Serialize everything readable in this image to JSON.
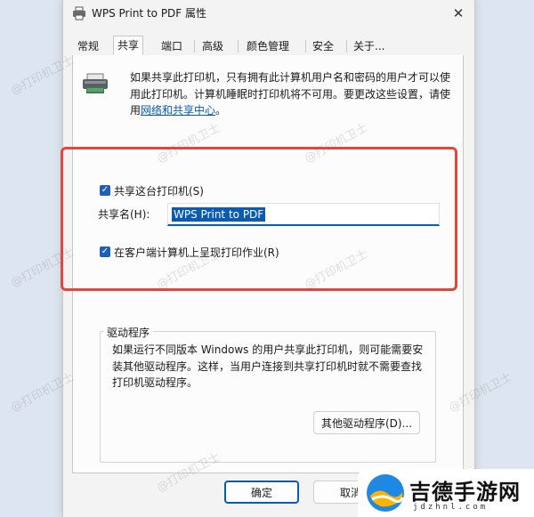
{
  "window": {
    "title": "WPS Print to PDF 属性",
    "close_glyph": "✕"
  },
  "tabs": [
    {
      "label": "常规"
    },
    {
      "label": "共享",
      "active": true
    },
    {
      "label": "端口"
    },
    {
      "label": "高级"
    },
    {
      "label": "颜色管理"
    },
    {
      "label": "安全"
    },
    {
      "label": "关于..."
    }
  ],
  "info": {
    "line1": "如果共享此打印机，只有拥有此计算机用户名和密码的用户才可以使",
    "line2": "用此打印机。计算机睡眠时打印机将不可用。要更改这些设置，请使",
    "line3_prefix": "用",
    "link": "网络和共享中心",
    "line3_suffix": "。"
  },
  "share": {
    "checkbox_label": "共享这台打印机(S)",
    "checked": true,
    "name_label": "共享名(H):",
    "name_value": "WPS Print to PDF",
    "render_label": "在客户端计算机上呈现打印作业(R)",
    "render_checked": true
  },
  "drivers": {
    "legend": "驱动程序",
    "line1": "如果运行不同版本 Windows 的用户共享此打印机，则可能需要安",
    "line2": "装其他驱动程序。这样，当用户连接到共享打印机时就不需要查找",
    "line3": "打印机驱动程序。",
    "button_label": "其他驱动程序(D)..."
  },
  "buttons": {
    "ok": "确定",
    "cancel": "取消"
  },
  "watermark_text": "@打印机卫士",
  "site_logo": {
    "title": "吉德手游网",
    "domain": "jdzhnl.com"
  },
  "colors": {
    "accent": "#0a5bb3",
    "highlight": "#e2463e",
    "checkbox": "#1f5fb8"
  }
}
